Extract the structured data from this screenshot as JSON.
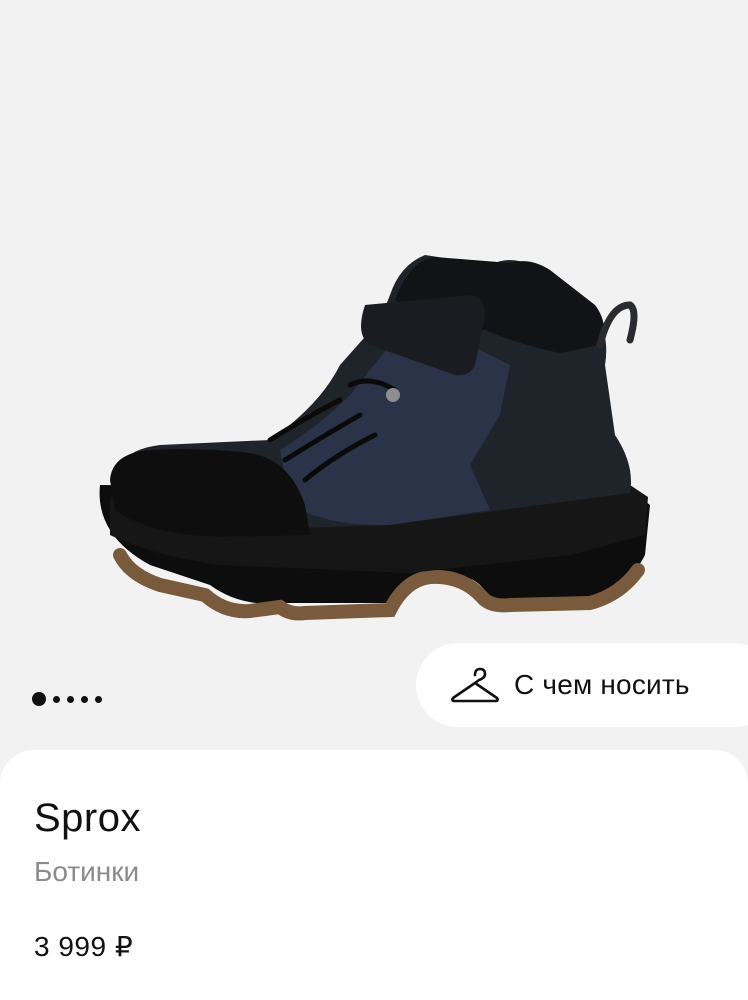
{
  "gallery": {
    "image_alt": "product-boot-photo",
    "slide_count": 5,
    "active_slide": 1
  },
  "outfit": {
    "label": "С чем носить",
    "icon": "hanger-icon"
  },
  "product": {
    "brand": "Sprox",
    "category": "Ботинки",
    "price": "3 999 ₽"
  },
  "colors": {
    "page_background": "#f2f2f2",
    "card_background": "#ffffff",
    "text_primary": "#111111",
    "text_secondary": "#8a8a8a"
  }
}
